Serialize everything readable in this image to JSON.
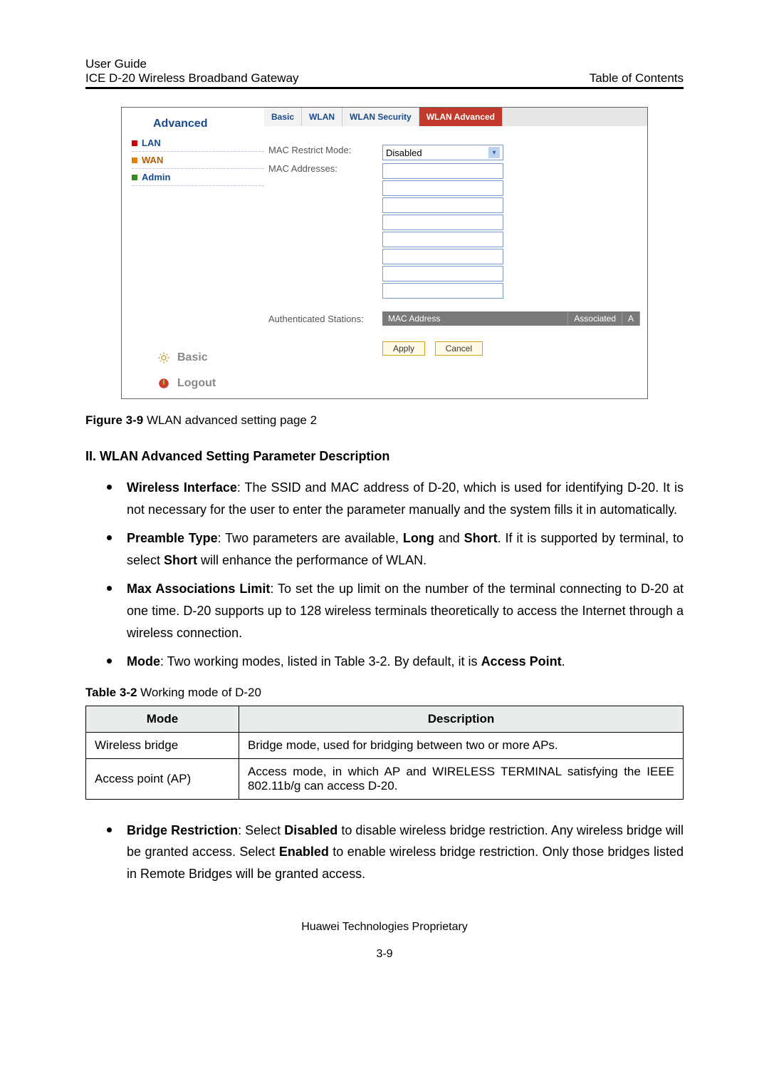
{
  "header": {
    "line1": "User Guide",
    "line2": "ICE D-20 Wireless Broadband Gateway",
    "right": "Table of Contents"
  },
  "screenshot": {
    "sidebar": {
      "title": "Advanced",
      "items": [
        "LAN",
        "WAN",
        "Admin"
      ]
    },
    "tabs": [
      "Basic",
      "WLAN",
      "WLAN Security",
      "WLAN Advanced"
    ],
    "form": {
      "mac_restrict_label": "MAC Restrict Mode:",
      "mac_restrict_value": "Disabled",
      "mac_addresses_label": "MAC Addresses:",
      "auth_label": "Authenticated Stations:",
      "auth_cols": [
        "MAC Address",
        "Associated",
        "A"
      ],
      "apply": "Apply",
      "cancel": "Cancel"
    },
    "bottom": {
      "basic": "Basic",
      "logout": "Logout"
    }
  },
  "caption": {
    "prefix": "Figure 3-9 ",
    "text": "WLAN advanced setting page 2"
  },
  "section_heading": "II. WLAN Advanced Setting Parameter Description",
  "bullets1": [
    {
      "b": "Wireless Interface",
      "t": ": The SSID and MAC address of D-20, which is used for identifying D-20. It is not necessary for the user to enter the parameter manually and the system fills it in automatically."
    },
    {
      "b": "Preamble Type",
      "t_before": ": Two parameters are available, ",
      "bold2": "Long",
      "mid": " and ",
      "bold3": "Short",
      "t_after": ". If it is supported by terminal, to select ",
      "bold4": "Short",
      "t_end": " will enhance the performance of WLAN."
    },
    {
      "b": "Max Associations Limit",
      "t": ": To set the up limit on the number of the terminal connecting to D-20 at one time. D-20 supports up to 128 wireless terminals theoretically to access the Internet through a wireless connection."
    },
    {
      "b": "Mode",
      "t_before": ": Two working modes, listed in Table 3-2. By default, it is ",
      "bold2": "Access Point",
      "t_after": "."
    }
  ],
  "table_caption": {
    "prefix": "Table 3-2 ",
    "text": "Working mode of D-20"
  },
  "table": {
    "headers": [
      "Mode",
      "Description"
    ],
    "rows": [
      [
        "Wireless bridge",
        "Bridge mode, used for bridging between two or more APs."
      ],
      [
        "Access point (AP)",
        "Access mode, in which AP and WIRELESS TERMINAL satisfying the IEEE 802.11b/g can access D-20."
      ]
    ]
  },
  "bullets2": [
    {
      "b": "Bridge Restriction",
      "t_before": ": Select ",
      "bold2": "Disabled",
      "mid": " to disable wireless bridge restriction. Any wireless bridge will be granted access. Select ",
      "bold3": "Enabled",
      "t_after": " to enable wireless bridge restriction. Only those bridges listed in Remote Bridges will be granted access."
    }
  ],
  "footer": {
    "company": "Huawei Technologies Proprietary",
    "page": "3-9"
  }
}
